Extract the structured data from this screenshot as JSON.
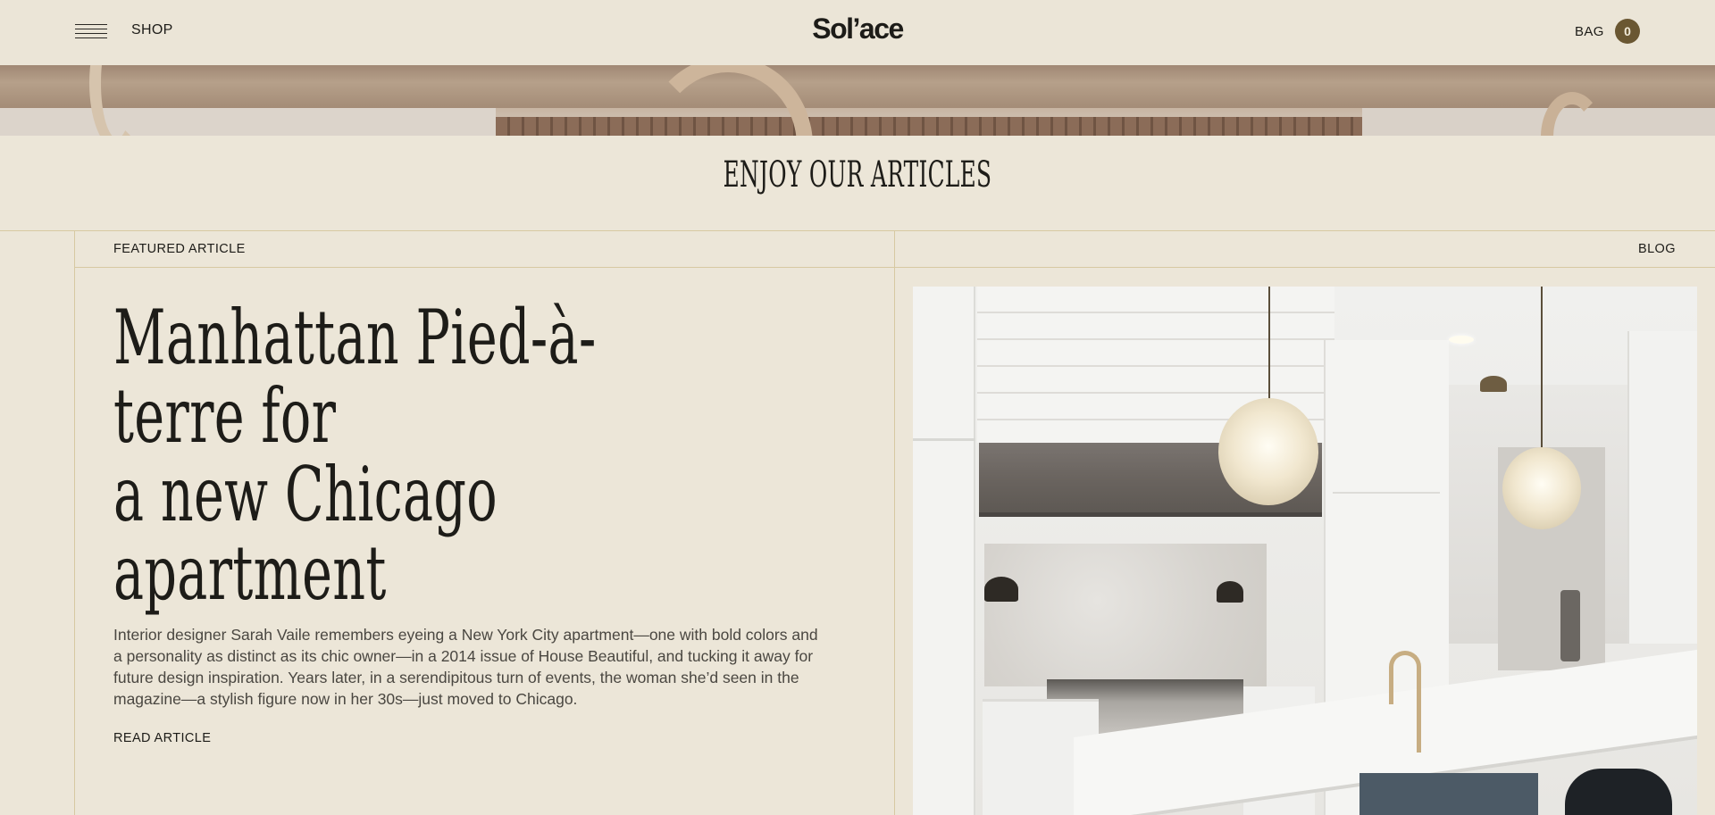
{
  "header": {
    "shop_label": "SHOP",
    "brand": "Sol’ace",
    "bag_label": "BAG",
    "bag_count": "0",
    "menu_icon": "hamburger-menu-icon"
  },
  "section": {
    "title": "ENJOY OUR ARTICLES"
  },
  "featured": {
    "label": "FEATURED ARTICLE",
    "category": "BLOG",
    "headline_line1": "Manhattan Pied-à-terre for",
    "headline_line2": "a new Chicago apartment",
    "excerpt": "Interior designer Sarah Vaile remembers eyeing a New York City apartment—one with bold colors and a personality as distinct as its chic owner—in a 2014 issue of House Beautiful, and tucking it away for future design inspiration. Years later, in a serendipitous turn of events, the woman she’d seen in the magazine—a stylish figure now in her 30s—just moved to Chicago.",
    "read_label": "READ ARTICLE"
  },
  "colors": {
    "background": "#ece6d8",
    "text": "#1d1c18",
    "accent": "#6a5732",
    "divider": "#d7c9a2"
  }
}
